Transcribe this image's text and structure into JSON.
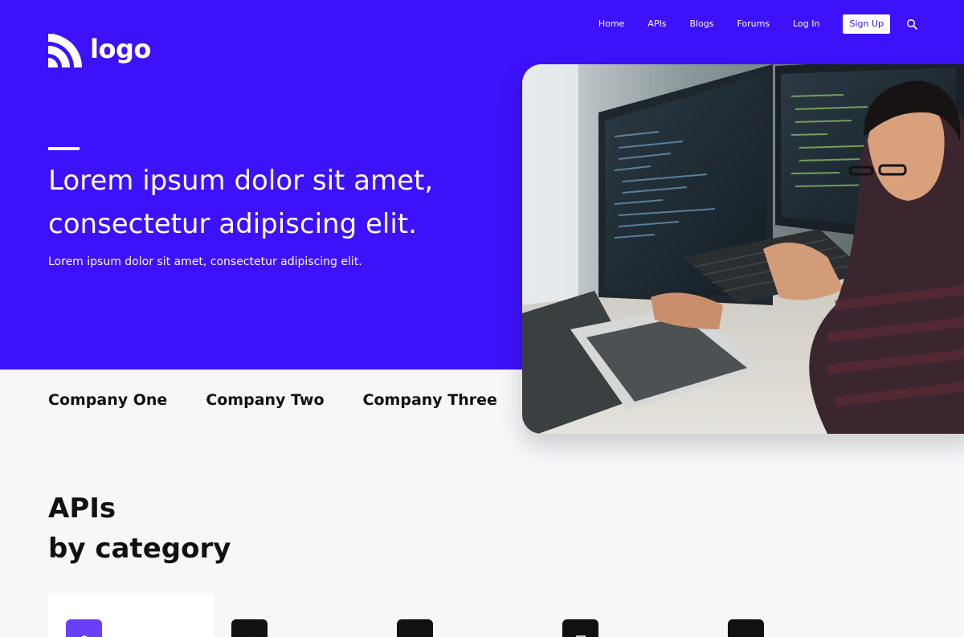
{
  "brand": {
    "logo_text": "logo"
  },
  "nav": {
    "links": [
      "Home",
      "APIs",
      "Blogs",
      "Forums",
      "Log In"
    ],
    "signup_label": "Sign Up",
    "search_icon": "search-icon"
  },
  "hero": {
    "title": "Lorem ipsum dolor sit amet, consectetur adipiscing elit.",
    "subtitle": "Lorem ipsum dolor sit amet, consectetur adipiscing elit.",
    "image_subject": "developer coding at desk with monitors and laptop"
  },
  "companies": [
    "Company One",
    "Company Two",
    "Company Three"
  ],
  "section": {
    "title_line1": "APIs",
    "title_line2": "by category"
  },
  "categories": [
    {
      "icon": "lock-icon",
      "active": true
    },
    {
      "icon": "globe-icon",
      "active": false
    },
    {
      "icon": "store-icon",
      "active": false
    },
    {
      "icon": "receipt-icon",
      "active": false
    },
    {
      "icon": "browser-window-icon",
      "active": false
    }
  ],
  "colors": {
    "primary": "#3d12fa",
    "accent": "#6a40f7",
    "background": "#f7f7fa",
    "text": "#111111"
  }
}
